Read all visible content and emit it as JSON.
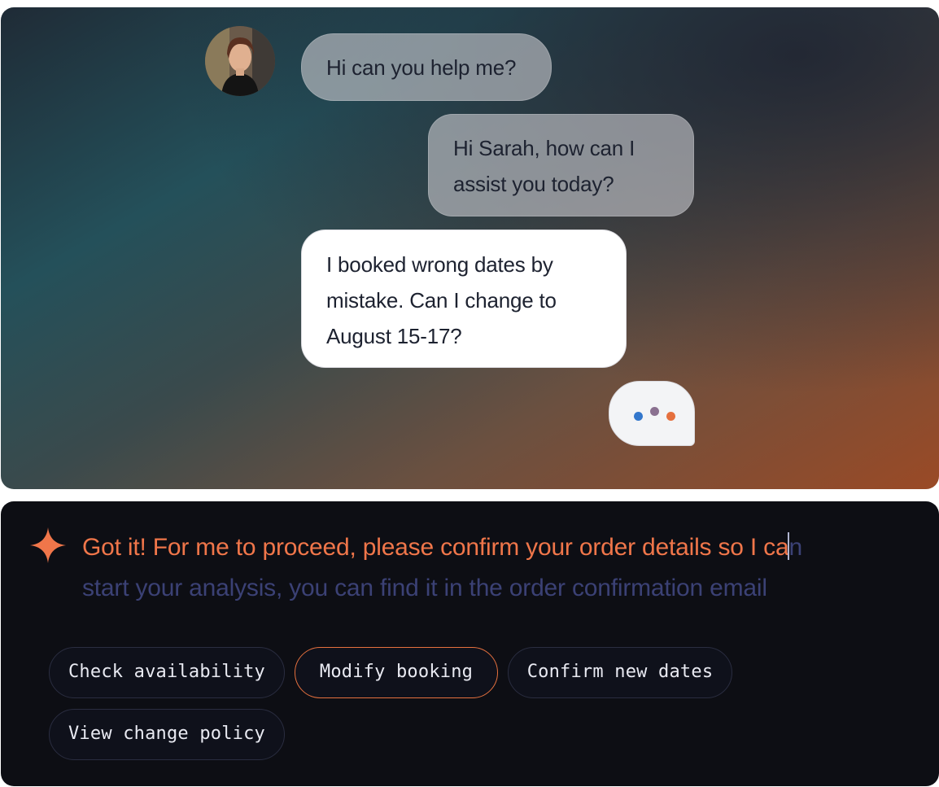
{
  "conversation": {
    "user_message_1": "Hi can you help me?",
    "agent_message_1_line_1": "Hi Sarah, how can I",
    "agent_message_1_line_2": "assist you today?",
    "user_message_2_line_1": "I booked wrong dates by",
    "user_message_2_line_2": "mistake. Can I change to",
    "user_message_2_line_3": "August 15-17?",
    "typing_indicator_colors": [
      "#3377cc",
      "#8a7090",
      "#e5703e"
    ]
  },
  "assistant": {
    "icon": "sparkle-icon",
    "typed_text": "Got it! For me to proceed, please confirm your order details so I ca",
    "pending_text_1": "n",
    "pending_text_2": "start your analysis, you can find it in the order confirmation email",
    "accent_color": "#f0764a"
  },
  "suggestions": [
    {
      "label": "Check availability",
      "active": false
    },
    {
      "label": "Modify booking",
      "active": true
    },
    {
      "label": "Confirm new dates",
      "active": false
    },
    {
      "label": "View change policy",
      "active": false
    }
  ]
}
